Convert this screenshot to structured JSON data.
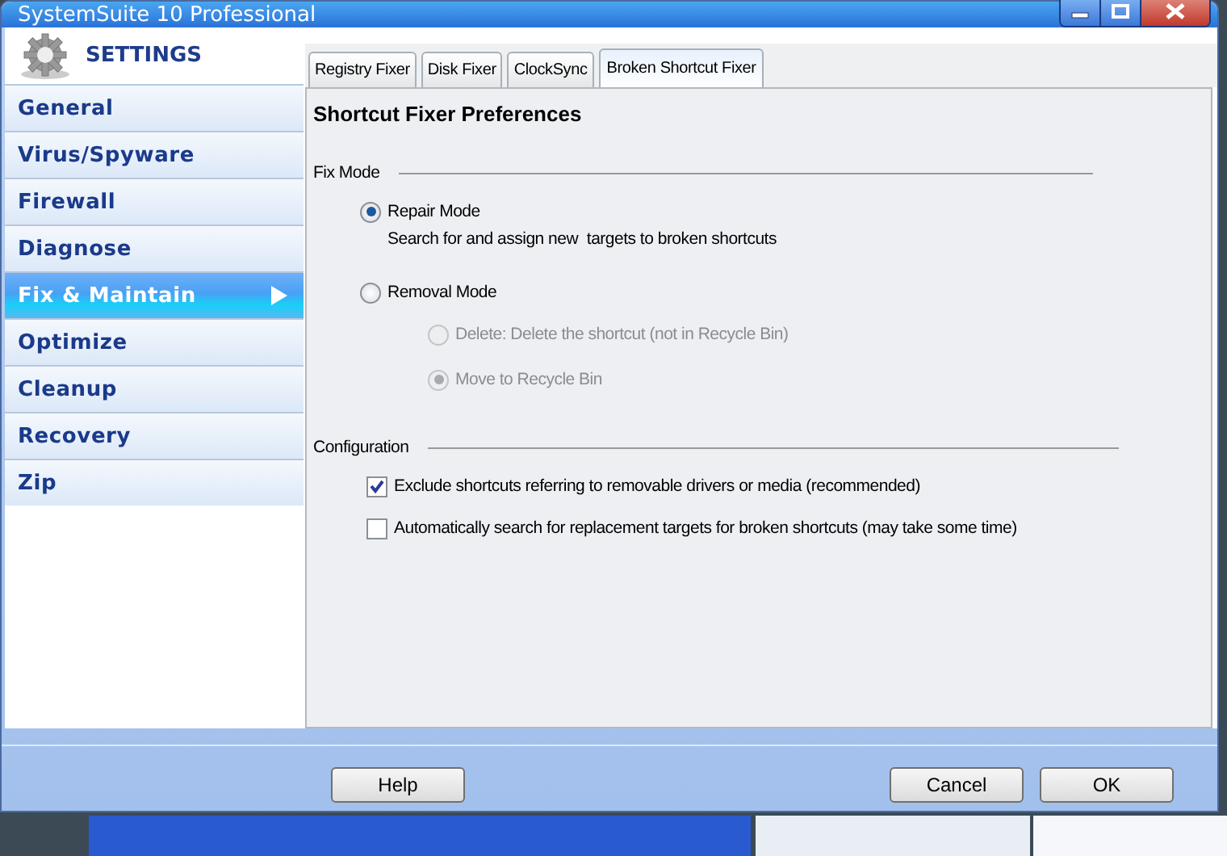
{
  "window": {
    "title": "SystemSuite 10 Professional"
  },
  "sidebar": {
    "header": "SETTINGS",
    "items": [
      {
        "label": "General",
        "selected": false
      },
      {
        "label": "Virus/Spyware",
        "selected": false
      },
      {
        "label": "Firewall",
        "selected": false
      },
      {
        "label": "Diagnose",
        "selected": false
      },
      {
        "label": "Fix & Maintain",
        "selected": true
      },
      {
        "label": "Optimize",
        "selected": false
      },
      {
        "label": "Cleanup",
        "selected": false
      },
      {
        "label": "Recovery",
        "selected": false
      },
      {
        "label": "Zip",
        "selected": false
      }
    ]
  },
  "tabs": [
    {
      "label": "Registry Fixer",
      "selected": false
    },
    {
      "label": "Disk Fixer",
      "selected": false
    },
    {
      "label": "ClockSync",
      "selected": false
    },
    {
      "label": "Broken Shortcut Fixer",
      "selected": true
    }
  ],
  "panel": {
    "title": "Shortcut Fixer Preferences",
    "sections": [
      {
        "title": "Fix Mode",
        "options": [
          {
            "kind": "radio",
            "label": "Repair Mode",
            "selected": true,
            "disabled": false,
            "description": "Search for and assign new  targets to broken shortcuts"
          },
          {
            "kind": "radio",
            "label": "Removal Mode",
            "selected": false,
            "disabled": false,
            "children": [
              {
                "kind": "radio",
                "label": "Delete: Delete the shortcut (not in Recycle Bin)",
                "selected": false,
                "disabled": true
              },
              {
                "kind": "radio",
                "label": "Move to Recycle Bin",
                "selected": true,
                "disabled": true
              }
            ]
          }
        ]
      },
      {
        "title": "Configuration",
        "options": [
          {
            "kind": "checkbox",
            "label": "Exclude shortcuts referring to removable drivers or media (recommended)",
            "checked": true
          },
          {
            "kind": "checkbox",
            "label": "Automatically search for replacement targets for broken shortcuts (may take some time)",
            "checked": false
          }
        ]
      }
    ]
  },
  "footer": {
    "help_button": "Help",
    "buttons": [
      "Cancel",
      "OK"
    ]
  }
}
